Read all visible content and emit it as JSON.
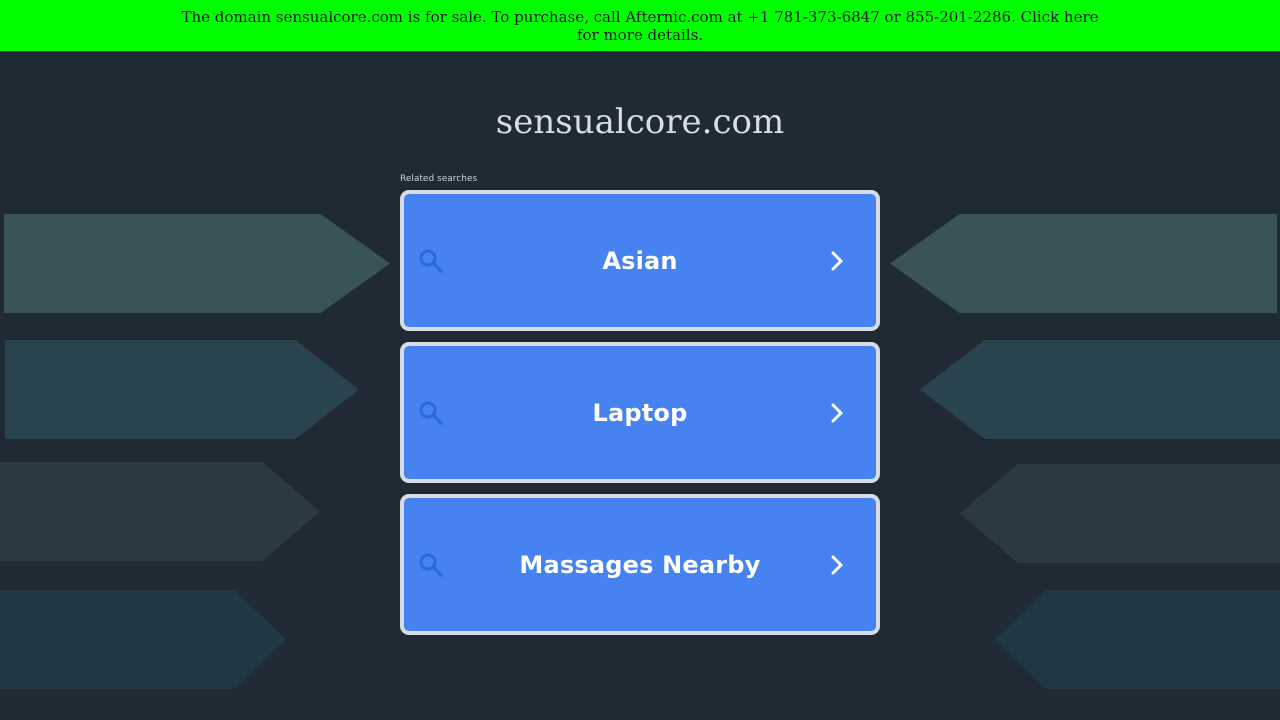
{
  "banner": {
    "text": "The domain sensualcore.com is for sale. To purchase, call Afternic.com at +1 781-373-6847 or 855-201-2286. Click here",
    "link_text": "for more details."
  },
  "site": {
    "domain": "sensualcore.com"
  },
  "related": {
    "label": "Related searches",
    "items": [
      {
        "label": "Asian",
        "icon": "search-icon"
      },
      {
        "label": "Laptop",
        "icon": "search-icon"
      },
      {
        "label": "Massages Nearby",
        "icon": "search-icon"
      }
    ]
  },
  "colors": {
    "banner_bg": "#00ff00",
    "page_bg": "#202a34",
    "card_bg": "#4682f0",
    "card_border": "#d6dde6",
    "search_icon": "#2a6bd8"
  }
}
